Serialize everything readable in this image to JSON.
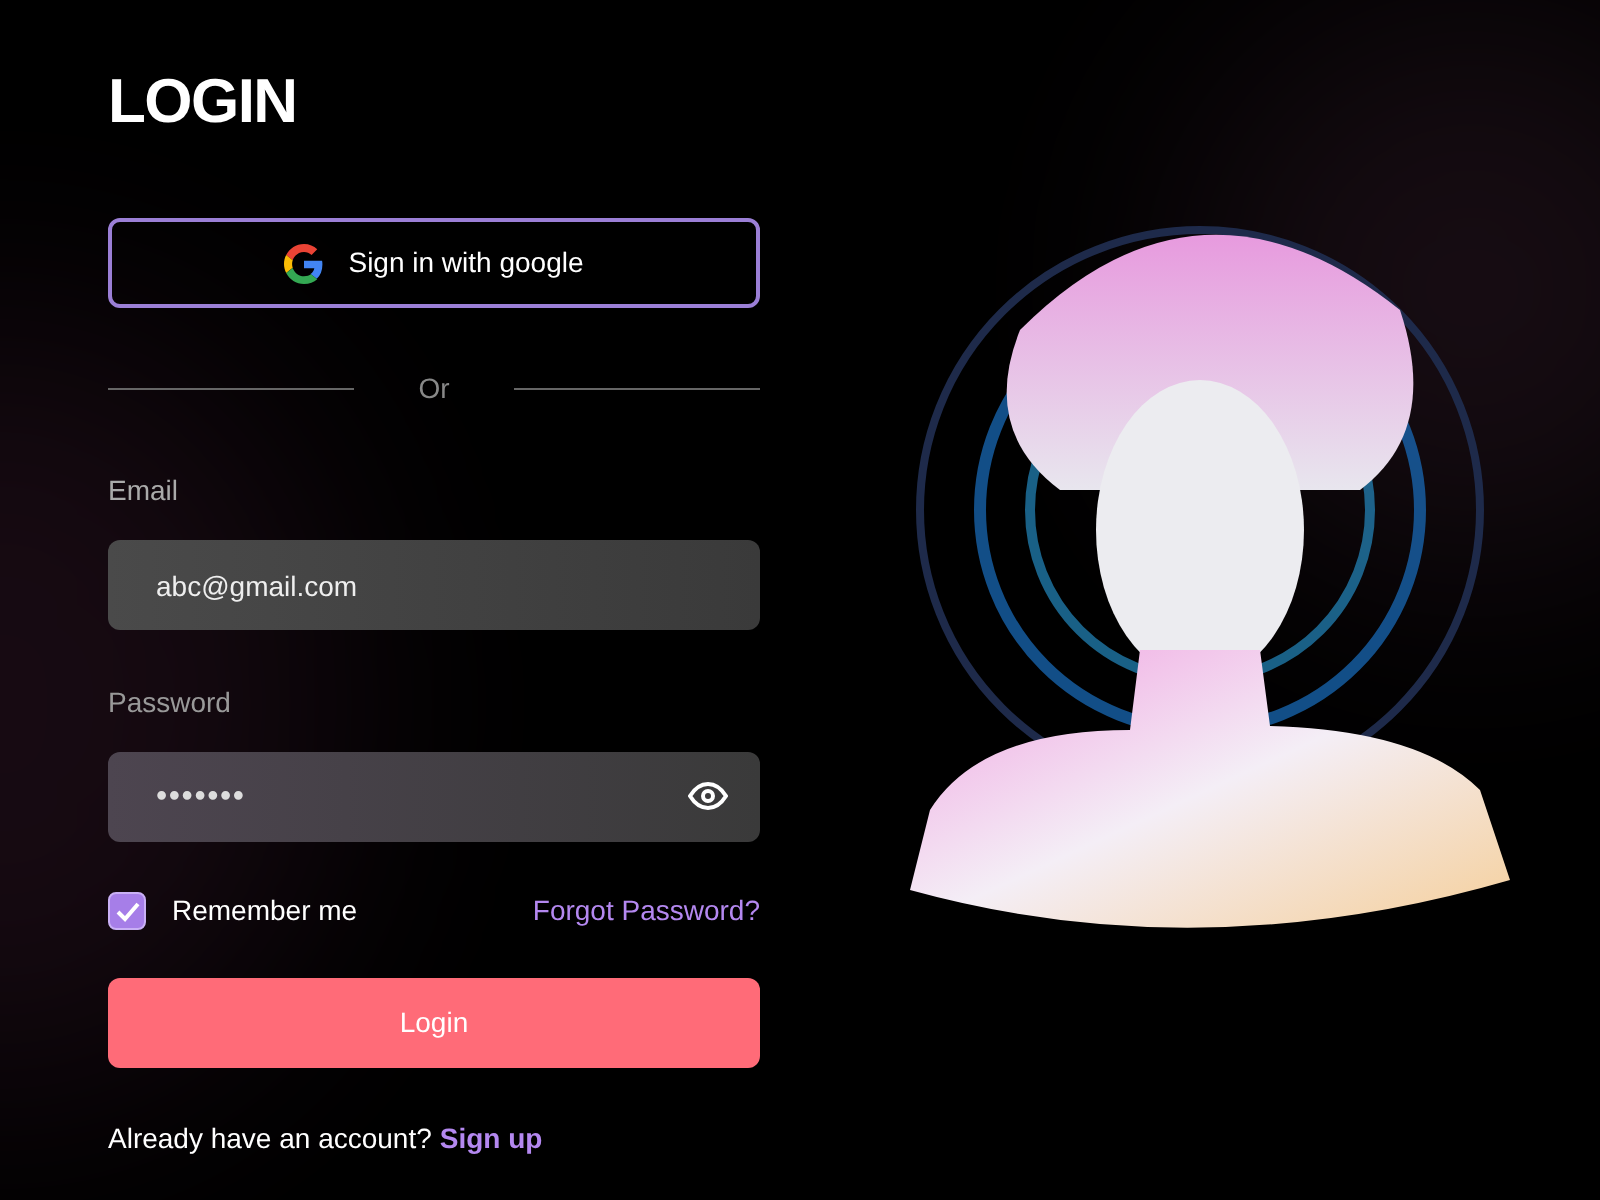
{
  "title": "LOGIN",
  "google_button": {
    "label": "Sign in with google"
  },
  "divider": {
    "label": "Or"
  },
  "email": {
    "label": "Email",
    "value": "abc@gmail.com"
  },
  "password": {
    "label": "Password",
    "value": "•••••••"
  },
  "remember": {
    "label": "Remember me",
    "checked": true
  },
  "forgot_link": "Forgot Password?",
  "login_button": "Login",
  "signup": {
    "prompt": "Already have an account?",
    "link": "Sign up"
  }
}
